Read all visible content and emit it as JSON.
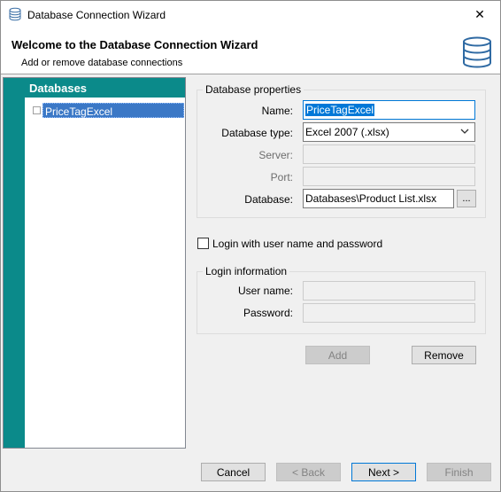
{
  "window": {
    "title": "Database Connection Wizard",
    "close_glyph": "✕"
  },
  "header": {
    "title": "Welcome to the Database Connection Wizard",
    "subtitle": "Add or remove database connections"
  },
  "sidebar": {
    "header": "Databases",
    "items": [
      {
        "label": "PriceTagExcel",
        "selected": true
      }
    ]
  },
  "db_properties": {
    "legend": "Database properties",
    "name_label": "Name:",
    "name_value": "PriceTagExcel",
    "type_label": "Database type:",
    "type_value": "Excel 2007 (.xlsx)",
    "server_label": "Server:",
    "server_value": "",
    "port_label": "Port:",
    "port_value": "",
    "database_label": "Database:",
    "database_value": "Databases\\Product List.xlsx",
    "browse_label": "..."
  },
  "login": {
    "checkbox_label": "Login with user name and password",
    "checked": false,
    "legend": "Login information",
    "user_label": "User name:",
    "user_value": "",
    "password_label": "Password:",
    "password_value": ""
  },
  "actions": {
    "add_label": "Add",
    "remove_label": "Remove"
  },
  "footer": {
    "cancel_label": "Cancel",
    "back_label": "< Back",
    "next_label": "Next >",
    "finish_label": "Finish"
  },
  "colors": {
    "accent": "#0b8a8a",
    "selection": "#3b78c6",
    "focus": "#0078d7"
  },
  "icons": {
    "app": "database-icon",
    "header": "database-stack-icon",
    "close": "close-icon",
    "dropdown": "chevron-down-icon"
  }
}
